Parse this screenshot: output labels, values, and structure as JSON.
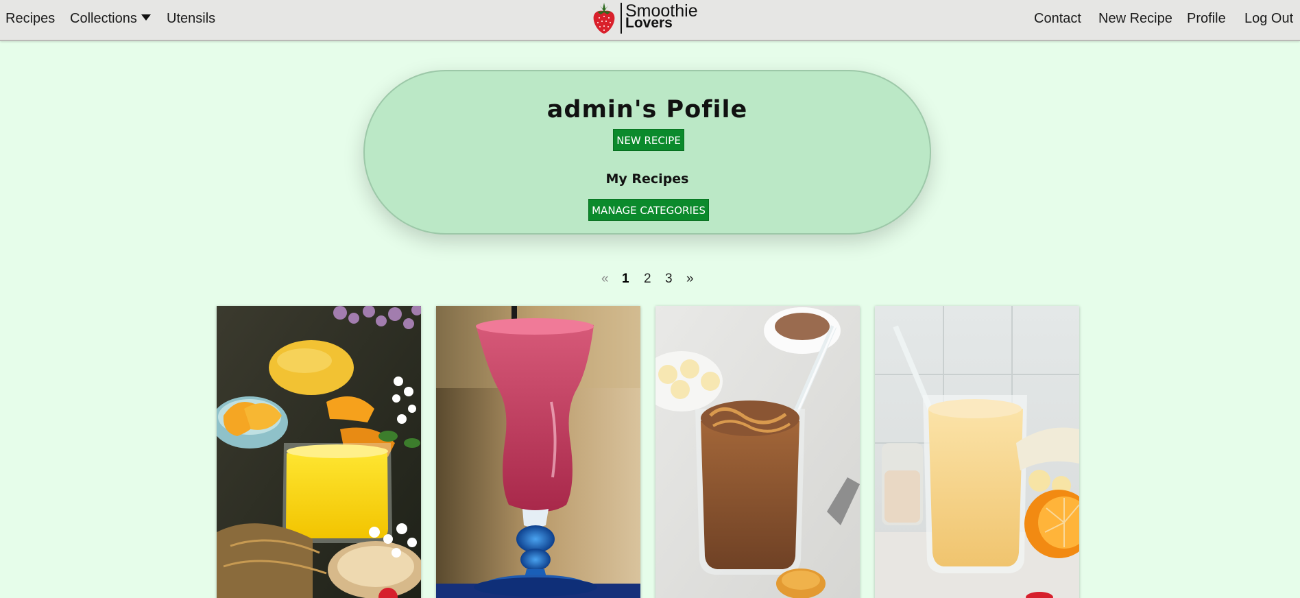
{
  "nav": {
    "left": [
      {
        "label": "Recipes"
      },
      {
        "label": "Collections"
      },
      {
        "label": "Utensils"
      }
    ],
    "right": [
      {
        "label": "Contact"
      },
      {
        "label": "New Recipe"
      },
      {
        "label": "Profile"
      },
      {
        "label": "Log Out"
      }
    ],
    "brand": {
      "line1": "Smoothie",
      "line2": "Lovers",
      "icon": "strawberry-icon"
    }
  },
  "profile": {
    "title": "admin's Pofile",
    "new_recipe_button": "NEW RECIPE",
    "section_title": "My Recipes",
    "manage_button": "MANAGE CATEGORIES"
  },
  "pagination": {
    "prev": "«",
    "pages": [
      "1",
      "2",
      "3"
    ],
    "current": "1",
    "next": "»"
  },
  "recipes": [
    {
      "image": "mango-smoothie-photo"
    },
    {
      "image": "berry-smoothie-photo"
    },
    {
      "image": "chocolate-peanut-smoothie-photo"
    },
    {
      "image": "orange-banana-smoothie-photo"
    }
  ],
  "colors": {
    "page_bg": "#e6fdea",
    "nav_bg": "#e6e6e4",
    "hero_bg": "#bbe8c6",
    "button_bg": "#0b8a2c",
    "brand_red": "#d9202b"
  }
}
